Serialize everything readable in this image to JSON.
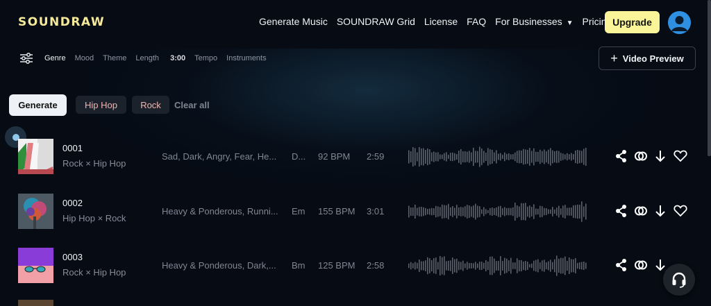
{
  "header": {
    "logo": "SOUNDRAW",
    "nav": [
      "Generate Music",
      "SOUNDRAW Grid",
      "License",
      "FAQ",
      "For Businesses",
      "Pricing"
    ],
    "upgrade_label": "Upgrade"
  },
  "filters": {
    "items": [
      "Genre",
      "Mood",
      "Theme"
    ],
    "length_label": "Length",
    "length_value": "3:00",
    "tempo": "Tempo",
    "instruments": "Instruments",
    "video_preview": "Video Preview"
  },
  "chips": {
    "generate": "Generate",
    "tags": [
      "Hip Hop",
      "Rock"
    ],
    "clear_all": "Clear all"
  },
  "tracks": [
    {
      "id": "0001",
      "genre": "Rock × Hip Hop",
      "mood": "Sad, Dark, Angry, Fear, He...",
      "key": "D...",
      "bpm": "92 BPM",
      "length": "2:59"
    },
    {
      "id": "0002",
      "genre": "Hip Hop × Rock",
      "mood": "Heavy & Ponderous, Runni...",
      "key": "Em",
      "bpm": "155 BPM",
      "length": "3:01"
    },
    {
      "id": "0003",
      "genre": "Rock × Hip Hop",
      "mood": "Heavy & Ponderous, Dark,...",
      "key": "Bm",
      "bpm": "125 BPM",
      "length": "2:58"
    }
  ],
  "icons": {
    "filter": "sliders-icon",
    "share": "share-icon",
    "link": "link-icon",
    "download": "download-icon",
    "favorite": "heart-icon",
    "support": "headset-icon",
    "avatar": "user-icon"
  },
  "colors": {
    "background": "#060b14",
    "logo": "#f6ea9a",
    "upgrade": "#fbf59a",
    "avatar": "#2f8fe0",
    "tag_text": "#f0b5b0"
  }
}
